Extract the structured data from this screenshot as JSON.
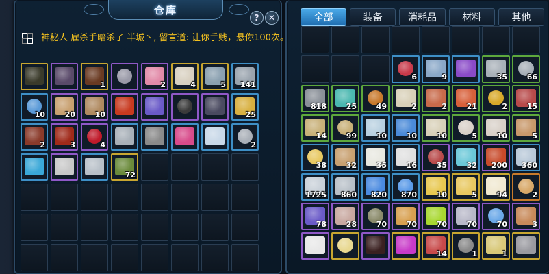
{
  "warehouse": {
    "title": "仓库",
    "help_glyph": "?",
    "close_glyph": "✕",
    "message": "神秘人 雇杀手暗杀了 半城丶, 留言道: 让你手贱，悬你100次。",
    "message_color": "#f2c020",
    "icons": [
      "help-icon",
      "close-icon",
      "chat-channel-icon"
    ],
    "slots": [
      {
        "rarity": "gold",
        "art": "#3a3a2a",
        "count": ""
      },
      {
        "rarity": "purple",
        "art": "#5a4a6a",
        "count": ""
      },
      {
        "rarity": "gold",
        "art": "#6a3a22",
        "count": "1"
      },
      {
        "rarity": "purple",
        "art": "#9a9aa8",
        "count": ""
      },
      {
        "rarity": "purple",
        "art": "#e28aa8",
        "count": "2"
      },
      {
        "rarity": "gold",
        "art": "#d8d0c0",
        "count": "4"
      },
      {
        "rarity": "gold",
        "art": "#8aa0b0",
        "count": "5"
      },
      {
        "rarity": "blue",
        "art": "#9aa4ae",
        "count": "141"
      },
      {
        "rarity": "blue",
        "art": "#5a9ad8",
        "count": "10"
      },
      {
        "rarity": "purple",
        "art": "#c8a070",
        "count": "20"
      },
      {
        "rarity": "purple",
        "art": "#b08a60",
        "count": "10"
      },
      {
        "rarity": "purple",
        "art": "#c83a20",
        "count": ""
      },
      {
        "rarity": "purple",
        "art": "#6a5ac8",
        "count": ""
      },
      {
        "rarity": "purple",
        "art": "#3a3a3a",
        "count": ""
      },
      {
        "rarity": "purple",
        "art": "#4a4a60",
        "count": ""
      },
      {
        "rarity": "blue",
        "art": "#d8b040",
        "count": "25"
      },
      {
        "rarity": "blue",
        "art": "#8a3a2a",
        "count": "2"
      },
      {
        "rarity": "purple",
        "art": "#a02a1a",
        "count": "3"
      },
      {
        "rarity": "purple",
        "art": "#c01a2a",
        "count": "4"
      },
      {
        "rarity": "blue",
        "art": "#a8b0b8",
        "count": ""
      },
      {
        "rarity": "blue",
        "art": "#8a8a8a",
        "count": ""
      },
      {
        "rarity": "blue",
        "art": "#d84a8a",
        "count": ""
      },
      {
        "rarity": "blue",
        "art": "#c8d8e8",
        "count": ""
      },
      {
        "rarity": "blue",
        "art": "#aab0b8",
        "count": "2"
      },
      {
        "rarity": "blue",
        "art": "#3aa8d8",
        "count": ""
      },
      {
        "rarity": "purple",
        "art": "#c8c8c8",
        "count": ""
      },
      {
        "rarity": "blue",
        "art": "#b8c0c8",
        "count": ""
      },
      {
        "rarity": "gold",
        "art": "#6a8a3a",
        "count": "72"
      }
    ]
  },
  "bag": {
    "tabs": [
      "全部",
      "装备",
      "消耗品",
      "材料",
      "其他"
    ],
    "active_tab": "全部",
    "rows": [
      [
        {
          "r": "empty"
        },
        {
          "r": "empty"
        },
        {
          "r": "empty"
        },
        {
          "r": "empty"
        },
        {
          "r": "empty"
        },
        {
          "r": "empty"
        },
        {
          "r": "empty"
        },
        {
          "r": "empty"
        }
      ],
      [
        {
          "r": "empty"
        },
        {
          "r": "empty"
        },
        {
          "r": "empty"
        },
        {
          "r": "blue",
          "a": "#c83a4a",
          "c": "6"
        },
        {
          "r": "blue",
          "a": "#8aa8c8",
          "c": "9"
        },
        {
          "r": "blue",
          "a": "#8a4ac8",
          "c": ""
        },
        {
          "r": "green",
          "a": "#a8b0b8",
          "c": "35"
        },
        {
          "r": "green",
          "a": "#a8b0b8",
          "c": "66"
        }
      ],
      [
        {
          "r": "green",
          "a": "#8a9098",
          "c": "818"
        },
        {
          "r": "green",
          "a": "#4ab8b0",
          "c": "25"
        },
        {
          "r": "green",
          "a": "#c8782a",
          "c": "49"
        },
        {
          "r": "green",
          "a": "#d8d0b8",
          "c": "2"
        },
        {
          "r": "green",
          "a": "#c86a4a",
          "c": "2"
        },
        {
          "r": "green",
          "a": "#d8603a",
          "c": "21"
        },
        {
          "r": "green",
          "a": "#d8a828",
          "c": "2"
        },
        {
          "r": "green",
          "a": "#b84a4a",
          "c": "15"
        }
      ],
      [
        {
          "r": "green",
          "a": "#c8b078",
          "c": "14"
        },
        {
          "r": "green",
          "a": "#c8b078",
          "c": "99"
        },
        {
          "r": "blue",
          "a": "#b8d0e0",
          "c": "10"
        },
        {
          "r": "blue",
          "a": "#4a8ad8",
          "c": "10"
        },
        {
          "r": "green",
          "a": "#d8d0b8",
          "c": "10"
        },
        {
          "r": "green",
          "a": "#d8d0c8",
          "c": "5"
        },
        {
          "r": "green",
          "a": "#d8d0c8",
          "c": "10"
        },
        {
          "r": "green",
          "a": "#c8986a",
          "c": "5"
        }
      ],
      [
        {
          "r": "blue",
          "a": "#e8c860",
          "c": "38"
        },
        {
          "r": "blue",
          "a": "#c8a070",
          "c": "32"
        },
        {
          "r": "blue",
          "a": "#e8e8e0",
          "c": "35"
        },
        {
          "r": "blue",
          "a": "#e0e0e0",
          "c": "16"
        },
        {
          "r": "purple",
          "a": "#b84a4a",
          "c": "35"
        },
        {
          "r": "blue",
          "a": "#6ac8d8",
          "c": "32"
        },
        {
          "r": "purple",
          "a": "#c84a2a",
          "c": "200"
        },
        {
          "r": "blue",
          "a": "#b8c8d8",
          "c": "360"
        }
      ],
      [
        {
          "r": "blue",
          "a": "#c8d0d8",
          "c": "1725"
        },
        {
          "r": "blue",
          "a": "#b8c0c8",
          "c": "860"
        },
        {
          "r": "blue",
          "a": "#4a8ae0",
          "c": "820"
        },
        {
          "r": "blue",
          "a": "#5a9ae8",
          "c": "870"
        },
        {
          "r": "gold",
          "a": "#e8c850",
          "c": "10"
        },
        {
          "r": "gold",
          "a": "#e8c860",
          "c": "5"
        },
        {
          "r": "gold",
          "a": "#f0e8d0",
          "c": "94"
        },
        {
          "r": "orange",
          "a": "#d8a868",
          "c": "2"
        }
      ],
      [
        {
          "r": "purple",
          "a": "#6a5ac8",
          "c": "78"
        },
        {
          "r": "purple",
          "a": "#c8a8a0",
          "c": "28"
        },
        {
          "r": "purple",
          "a": "#8a8a6a",
          "c": "70"
        },
        {
          "r": "purple",
          "a": "#d8a050",
          "c": "70"
        },
        {
          "r": "purple",
          "a": "#a8d830",
          "c": "70"
        },
        {
          "r": "purple",
          "a": "#b8b8c8",
          "c": "70"
        },
        {
          "r": "purple",
          "a": "#6aa8e8",
          "c": "70"
        },
        {
          "r": "purple",
          "a": "#c88a5a",
          "c": "3"
        }
      ],
      [
        {
          "r": "purple",
          "a": "#e8e8e8",
          "c": ""
        },
        {
          "r": "gold",
          "a": "#e8d890",
          "c": ""
        },
        {
          "r": "purple",
          "a": "#3a2020",
          "c": ""
        },
        {
          "r": "gold",
          "a": "#c83ac8",
          "c": ""
        },
        {
          "r": "gold",
          "a": "#c84a4a",
          "c": "14"
        },
        {
          "r": "gold",
          "a": "#8a8a8a",
          "c": "1"
        },
        {
          "r": "gold",
          "a": "#d8c878",
          "c": "1"
        },
        {
          "r": "gold",
          "a": "#9a9aa0",
          "c": ""
        }
      ]
    ]
  }
}
